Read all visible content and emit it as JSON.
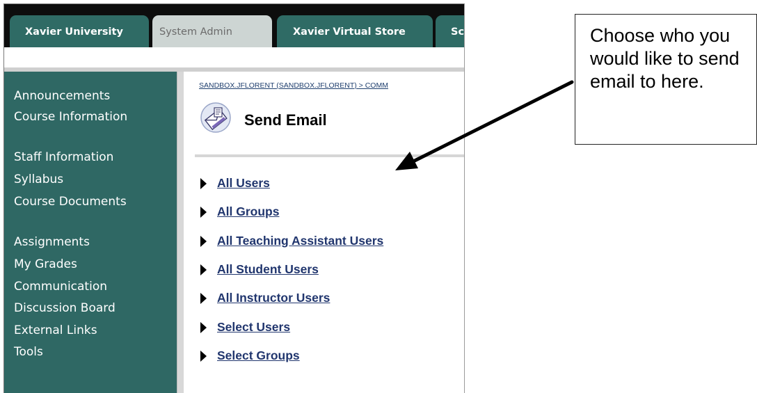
{
  "tabs": [
    {
      "label": "Xavier University",
      "active": false
    },
    {
      "label": "System Admin",
      "active": true
    },
    {
      "label": "Xavier Virtual Store",
      "active": false
    },
    {
      "label": "Sc",
      "active": false
    }
  ],
  "sidebar": {
    "items": [
      {
        "label": "Announcements"
      },
      {
        "label": "Course Information"
      },
      {
        "label": "Staff Information"
      },
      {
        "label": "Syllabus"
      },
      {
        "label": "Course Documents"
      },
      {
        "label": "Assignments"
      },
      {
        "label": "My Grades"
      },
      {
        "label": "Communication"
      },
      {
        "label": "Discussion Board"
      },
      {
        "label": "External Links"
      },
      {
        "label": "Tools"
      }
    ]
  },
  "content": {
    "breadcrumb": "SANDBOX.JFLORENT (SANDBOX.JFLORENT) > COMM",
    "title": "Send Email",
    "title_icon": "email-envelope-icon",
    "options": [
      {
        "label": "All Users"
      },
      {
        "label": "All Groups"
      },
      {
        "label": "All Teaching Assistant Users"
      },
      {
        "label": "All Student Users"
      },
      {
        "label": "All Instructor Users"
      },
      {
        "label": "Select Users"
      },
      {
        "label": "Select Groups"
      }
    ]
  },
  "callout": {
    "text": "Choose who you would like to send email to here."
  },
  "colors": {
    "sidebar_bg": "#2f6864",
    "tab_bg": "#2f6b65",
    "active_tab_bg": "#cdd5d3",
    "link": "#21366e"
  }
}
